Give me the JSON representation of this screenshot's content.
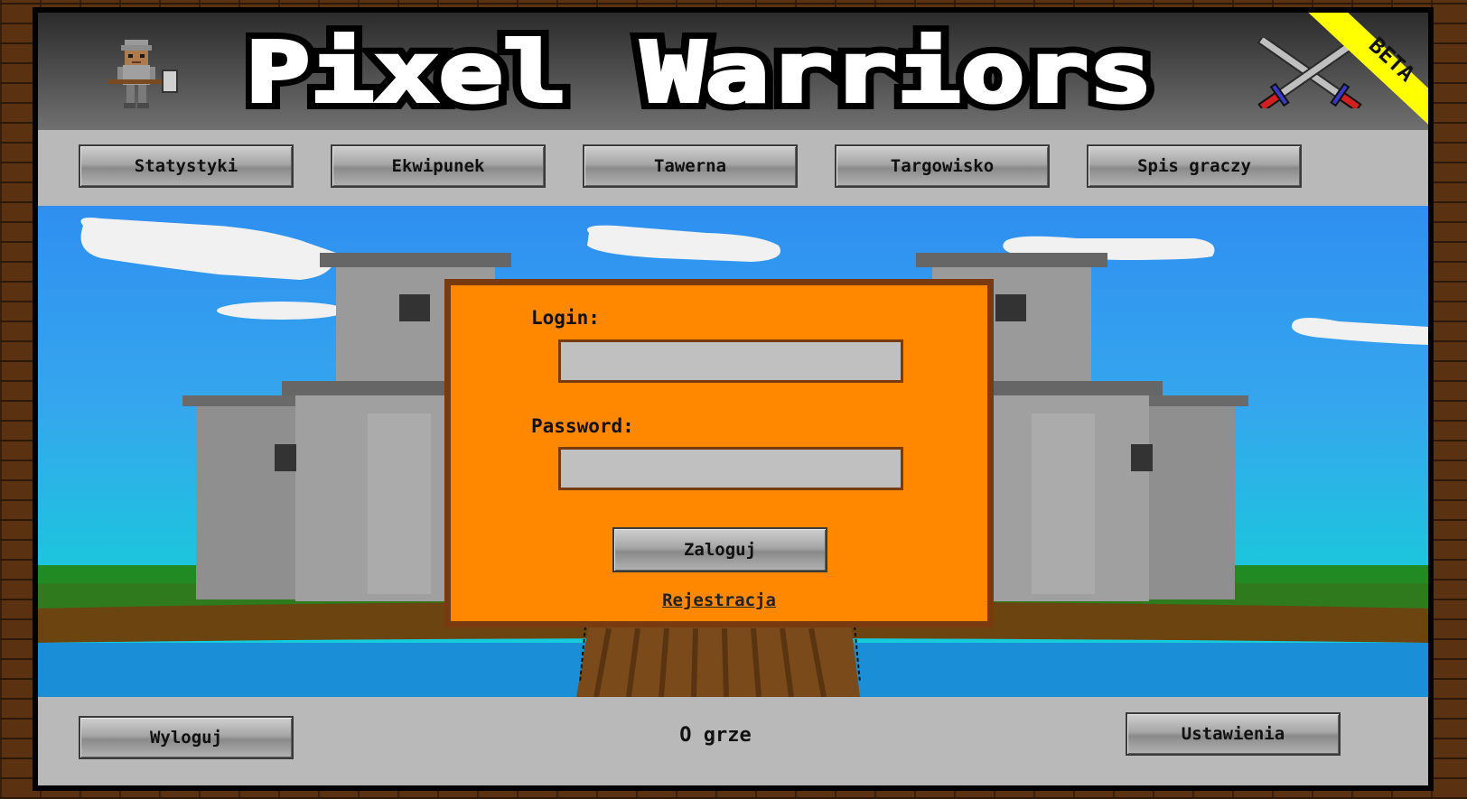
{
  "header": {
    "title": "Pixel Warriors",
    "title_words": [
      "Pixel",
      "Warriors"
    ],
    "badge": "BETA",
    "left_icon": "warrior-icon",
    "right_icon": "crossed-swords-icon"
  },
  "nav": {
    "items": [
      {
        "label": "Statystyki"
      },
      {
        "label": "Ekwipunek"
      },
      {
        "label": "Tawerna"
      },
      {
        "label": "Targowisko"
      },
      {
        "label": "Spis graczy"
      }
    ]
  },
  "login": {
    "login_label": "Login:",
    "login_value": "",
    "password_label": "Password:",
    "password_value": "",
    "submit_label": "Zaloguj",
    "register_label": "Rejestracja"
  },
  "footer": {
    "logout_label": "Wyloguj",
    "about_label": "O grze",
    "settings_label": "Ustawienia"
  },
  "colors": {
    "panel": "#ff8800",
    "panel_border": "#7a3a10",
    "badge": "#ffff00",
    "sky": "#2f8ff0"
  }
}
